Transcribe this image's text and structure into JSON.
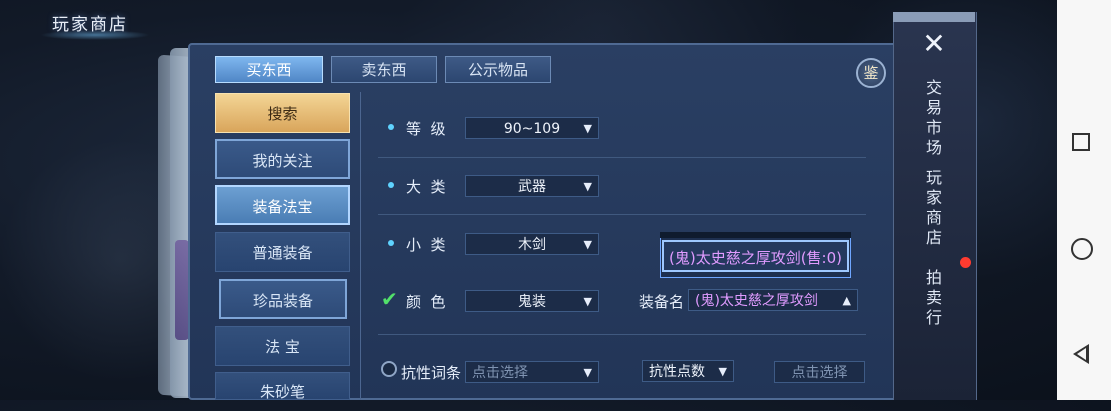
{
  "store_title": "玩家商店",
  "tabs": [
    {
      "label": "买东西",
      "active": true
    },
    {
      "label": "卖东西",
      "active": false
    },
    {
      "label": "公示物品",
      "active": false
    }
  ],
  "appraise_label": "鉴",
  "side_menu": [
    {
      "label": "搜索"
    },
    {
      "label": "我的关注"
    },
    {
      "label": "装备法宝"
    },
    {
      "label": "普通装备"
    },
    {
      "label": "珍品装备"
    },
    {
      "label": "法 宝"
    },
    {
      "label": "朱砂笔"
    }
  ],
  "filters": {
    "level": {
      "label": "等  级",
      "value": "90~109"
    },
    "category": {
      "label": "大  类",
      "value": "武器"
    },
    "subcategory": {
      "label": "小  类",
      "value": "木剑"
    },
    "color": {
      "label": "颜  色",
      "value": "鬼装",
      "checked": true
    },
    "equip_name": {
      "label": "装备名",
      "value": "(鬼)太史慈之厚攻剑"
    },
    "resist_entry": {
      "label": "抗性词条",
      "placeholder": "点击选择",
      "checked": false
    },
    "resist_points": {
      "label": "抗性点数",
      "placeholder": "点击选择"
    }
  },
  "suggestion": "(鬼)太史慈之厚攻剑(售:0)",
  "right_menu": [
    {
      "label": "交易市场"
    },
    {
      "label": "玩家商店"
    },
    {
      "label": "拍卖行"
    }
  ],
  "colors": {
    "accent": "#7fb7ef",
    "gold": "#f3d595",
    "ghost_purple": "#e09bff",
    "badge_red": "#ff3b30"
  },
  "icons": [
    "close-icon",
    "check-icon",
    "chevron-down-icon",
    "chevron-up-icon",
    "recent-apps-icon",
    "home-icon",
    "back-icon"
  ]
}
